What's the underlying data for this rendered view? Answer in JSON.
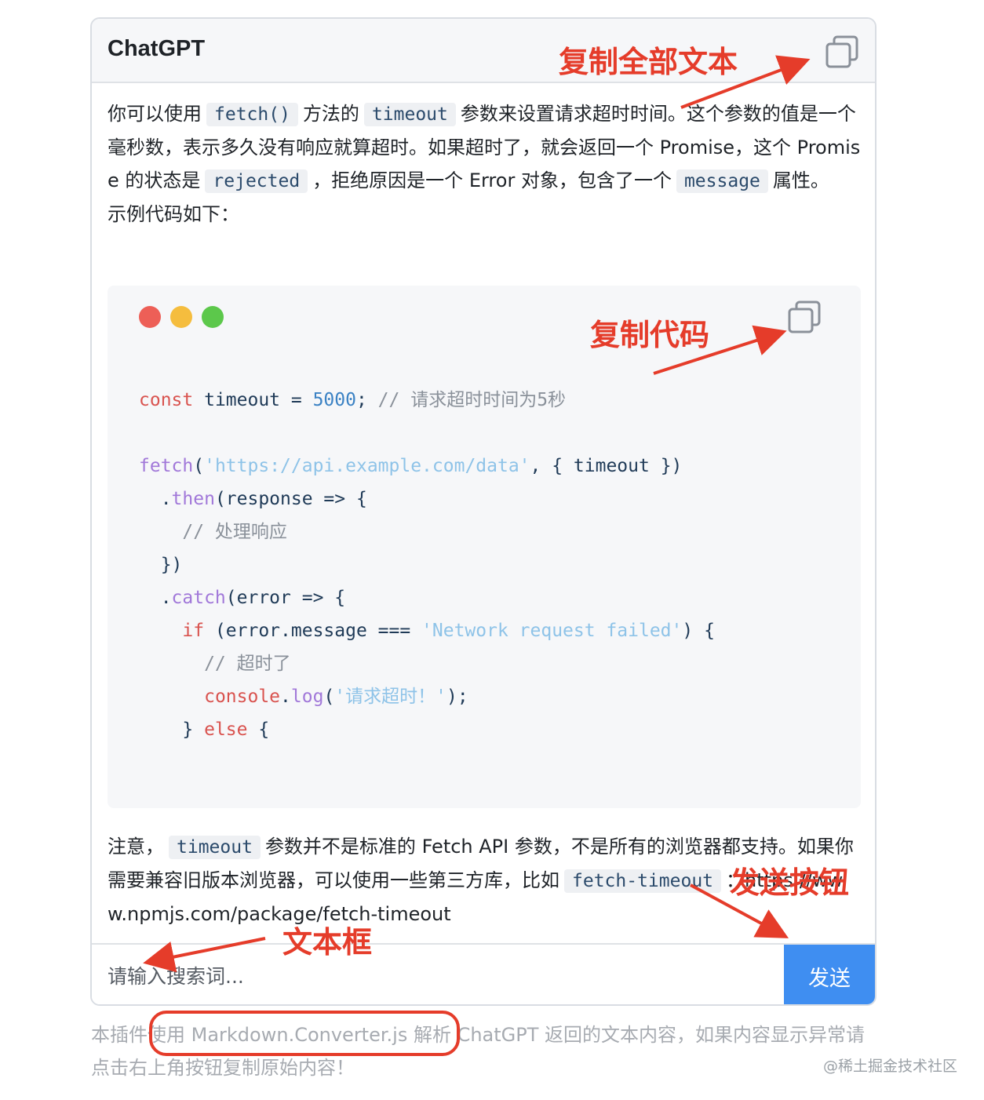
{
  "header": {
    "title": "ChatGPT"
  },
  "message": {
    "p1": [
      "你可以使用",
      "fetch()",
      "方法的",
      "timeout",
      "参数来设置请求超时时间。这个参数的值是一个毫秒数，表示多久没有响应就算超时。如果超时了，就会返回一个 Promise，这个 Promise 的状态是",
      "rejected",
      "，拒绝原因是一个 Error 对象，包含了一个",
      "message",
      "属性。"
    ],
    "p2": "示例代码如下：",
    "code": {
      "l1": [
        "const",
        " timeout = ",
        "5000",
        "; ",
        "// 请求超时时间为5秒"
      ],
      "l3": [
        "fetch",
        "(",
        "'https://api.example.com/data'",
        ", { timeout })"
      ],
      "l4": [
        "  .",
        "then",
        "(response => {"
      ],
      "l5": [
        "    // 处理响应"
      ],
      "l6": [
        "  })"
      ],
      "l7": [
        "  .",
        "catch",
        "(error => {"
      ],
      "l8": [
        "    ",
        "if",
        " (error.message === ",
        "'Network request failed'",
        ") {"
      ],
      "l9": [
        "      // 超时了"
      ],
      "l10": [
        "      ",
        "console",
        ".",
        "log",
        "(",
        "'请求超时！'",
        ");"
      ],
      "l11": [
        "    } ",
        "else",
        " {"
      ]
    },
    "note": [
      "注意，",
      "timeout",
      "参数并不是标准的 Fetch API 参数，不是所有的浏览器都支持。如果你需要兼容旧版本浏览器，可以使用一些第三方库，比如",
      "fetch-timeout",
      "：https://www.npmjs.com/package/fetch-timeout"
    ]
  },
  "input": {
    "placeholder": "请输入搜索词..."
  },
  "send_label": "发送",
  "footer": "本插件使用 Markdown.Converter.js 解析 ChatGPT 返回的文本内容，如果内容显示异常请点击右上角按钮复制原始内容！",
  "watermark": "@稀土掘金技术社区",
  "annotations": {
    "copy_all": "复制全部文本",
    "copy_code": "复制代码",
    "send_button": "发送按钮",
    "textbox": "文本框"
  },
  "colors": {
    "accent": "#3f8ef1",
    "annotation": "#e53c2a"
  }
}
